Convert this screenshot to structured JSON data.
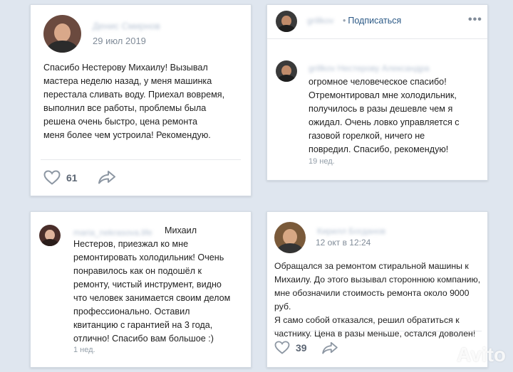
{
  "review1": {
    "author": "Денис Смирнов",
    "date": "29 июл 2019",
    "text": "Спасибо Нестерову Михаилу! Вызывал\nмастера неделю назад, у меня машинка\nперестала сливать воду. Приехал вовремя,\nвыполнил все работы, проблемы была\nрешена очень быстро, цена ремонта\nменя более чем устроила! Рекомендую.",
    "likes": "61"
  },
  "review2": {
    "header_user": "grillkov",
    "subscribe_label": "Подписаться",
    "subscribe_dot": "•",
    "menu_icon_label": "•••",
    "comment_author": "grillkov Нестерову Александра",
    "text": "огромное человеческое спасибо!\nОтремонтировал мне холодильник,\nполучилось в разы дешевле чем я\nожидал. Очень ловко управляется с\nгазовой горелкой, ничего не\nповредил. Спасибо, рекомендую!",
    "date": "19 нед."
  },
  "review3": {
    "author": "maria_nekrasova.life",
    "text_first": "Михаил",
    "text": "Нестеров, приезжал ко мне\nремонтировать холодильник! Очень\nпонравилось как он подошёл к\nремонту, чистый инструмент, видно\nчто человек занимается своим делом\nпрофессионально. Оставил\nквитанцию с гарантией на 3 года,\nотлично! Спасибо вам большое :)",
    "date": "1 нед."
  },
  "review4": {
    "author": "Кирилл Богданов",
    "date": "12 окт в 12:24",
    "text": "Обращался за ремонтом стиральной машины к\nМихаилу. До этого вызывал стороннюю компанию,\nмне обозначили стоимость ремонта около 9000 руб.\nЯ само собой отказался, решил обратиться к\nчастнику. Цена в разы меньше, остался доволен!",
    "likes": "39"
  },
  "watermark": "Avito",
  "colors": {
    "background": "#dfe6ef",
    "link": "#2a5885",
    "meta": "#818c99",
    "icon": "#8d97a3"
  }
}
